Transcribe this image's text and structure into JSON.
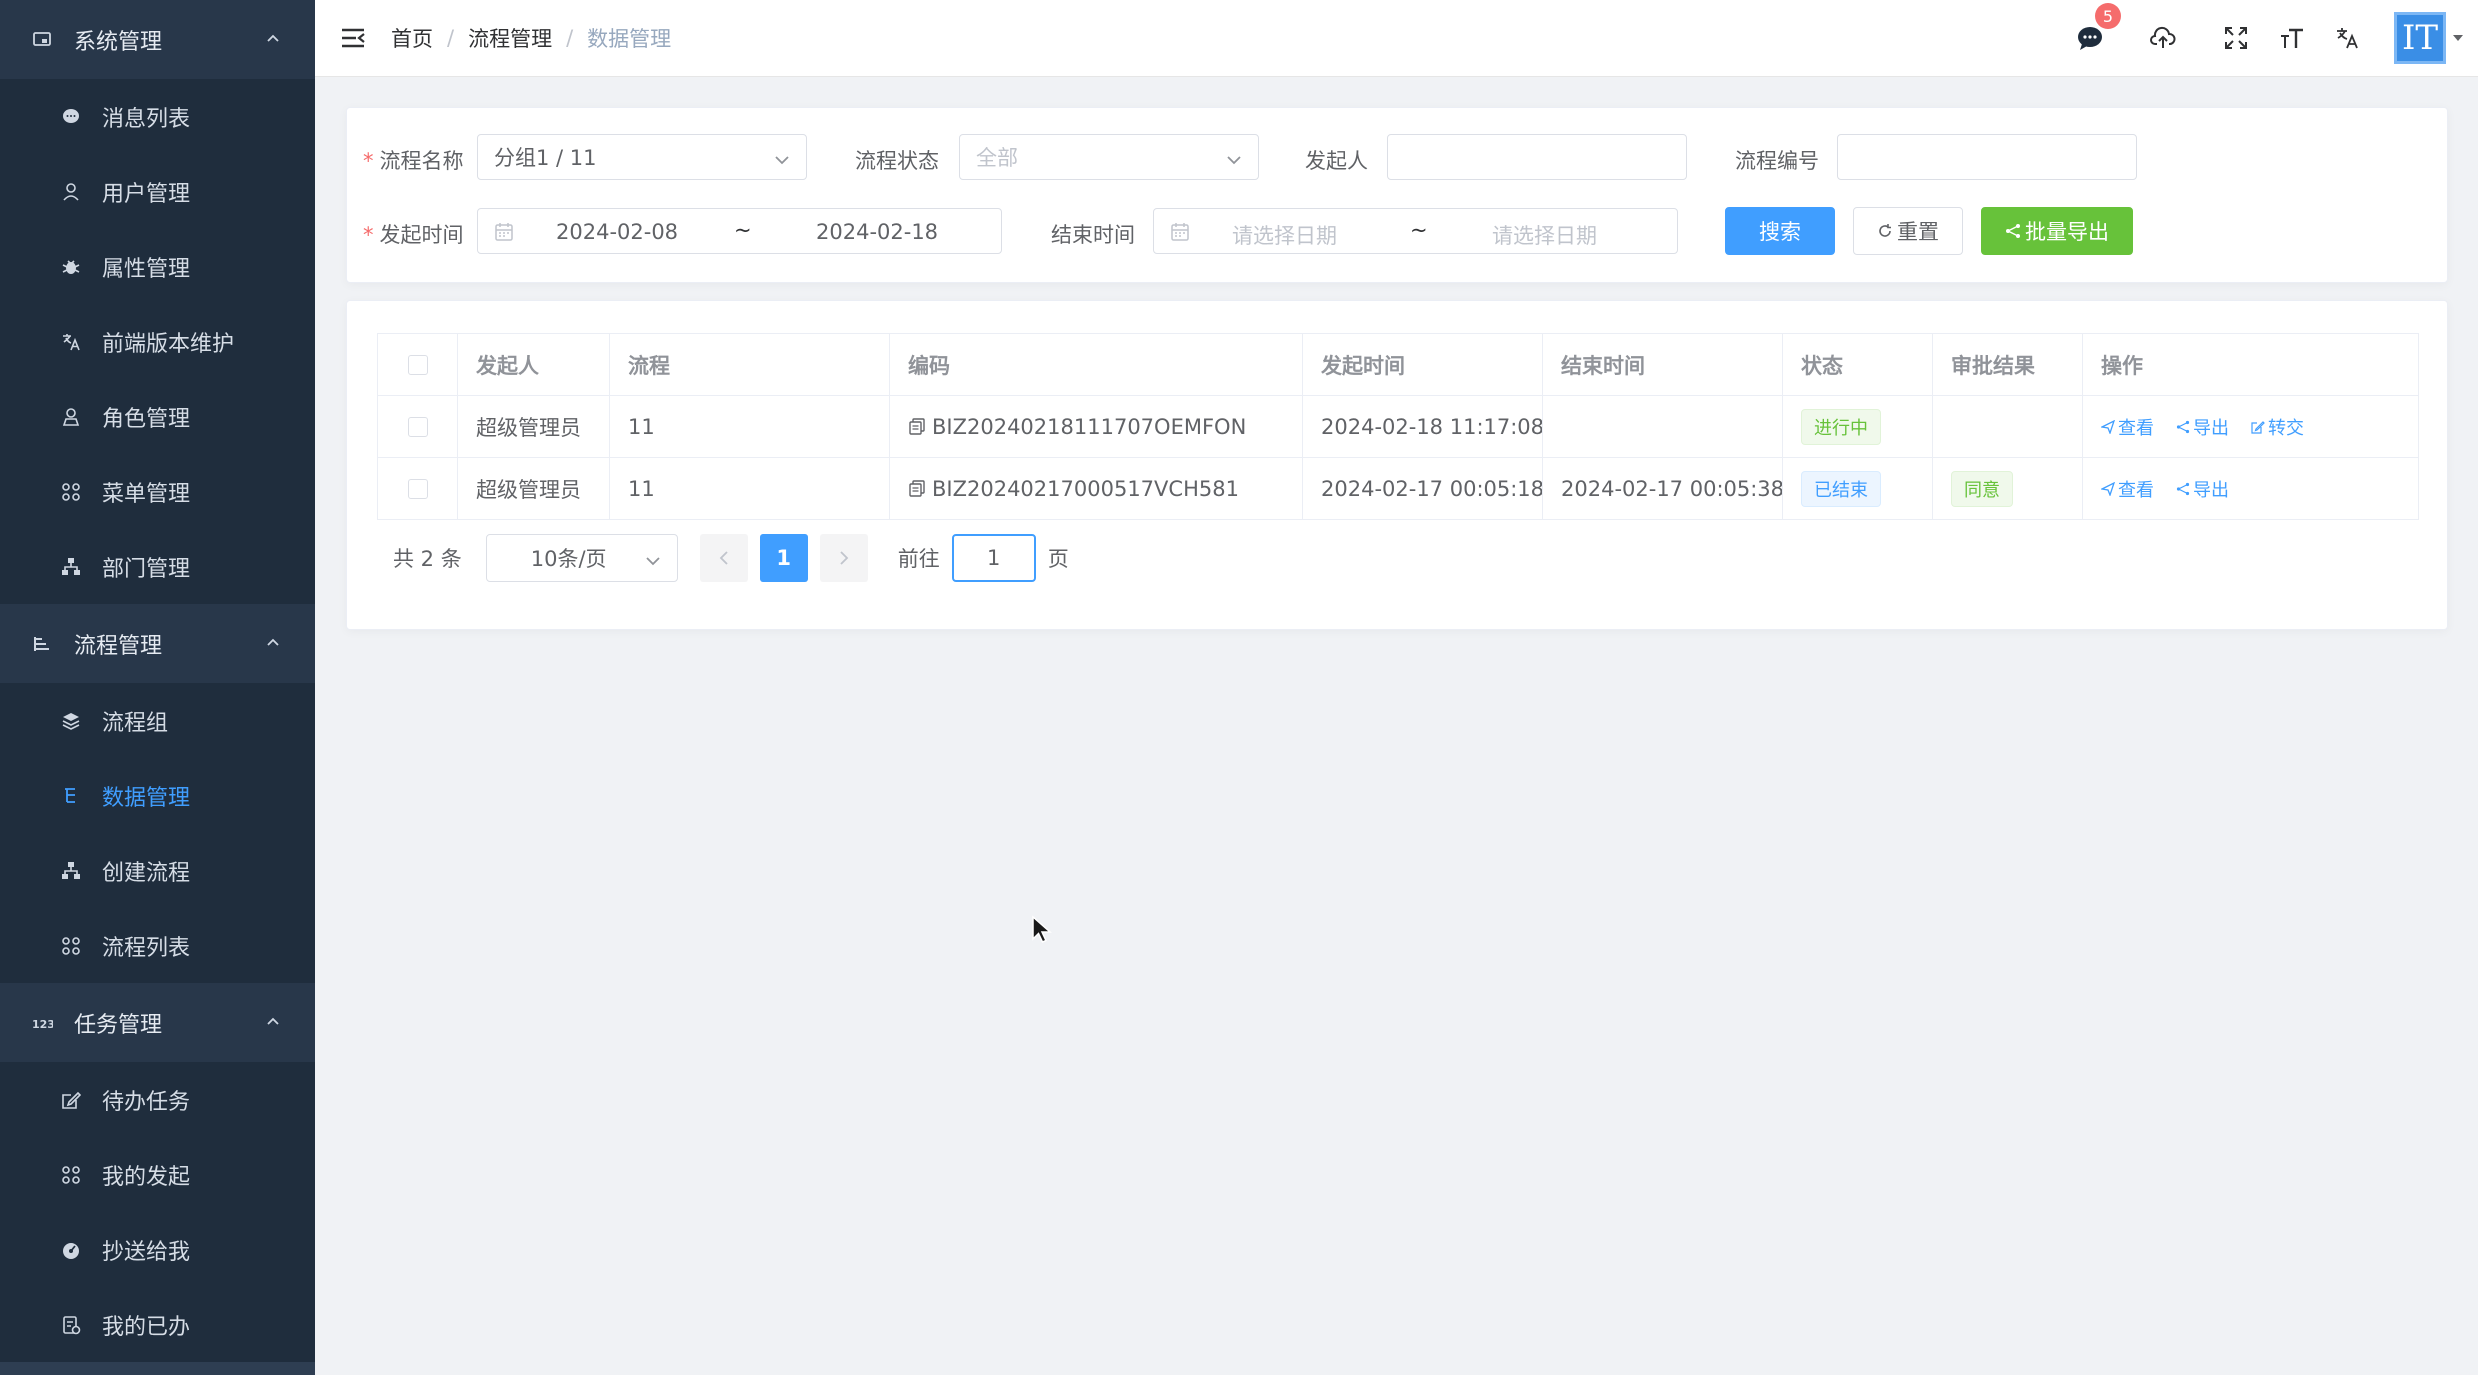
{
  "sidebar": {
    "groups": [
      {
        "label": "系统管理",
        "icon": "system-icon",
        "items": [
          {
            "label": "消息列表",
            "icon": "message-icon"
          },
          {
            "label": "用户管理",
            "icon": "user-icon"
          },
          {
            "label": "属性管理",
            "icon": "bug-icon"
          },
          {
            "label": "前端版本维护",
            "icon": "translate-icon"
          },
          {
            "label": "角色管理",
            "icon": "role-icon"
          },
          {
            "label": "菜单管理",
            "icon": "grid-icon"
          },
          {
            "label": "部门管理",
            "icon": "tree-icon"
          }
        ]
      },
      {
        "label": "流程管理",
        "icon": "flow-icon",
        "items": [
          {
            "label": "流程组",
            "icon": "layers-icon"
          },
          {
            "label": "数据管理",
            "icon": "data-icon",
            "active": true
          },
          {
            "label": "创建流程",
            "icon": "tree-icon"
          },
          {
            "label": "流程列表",
            "icon": "grid-icon"
          }
        ]
      },
      {
        "label": "任务管理",
        "icon": "number-icon",
        "items": [
          {
            "label": "待办任务",
            "icon": "edit-icon"
          },
          {
            "label": "我的发起",
            "icon": "grid-icon"
          },
          {
            "label": "抄送给我",
            "icon": "dashboard-icon"
          },
          {
            "label": "我的已办",
            "icon": "document-icon"
          }
        ]
      }
    ]
  },
  "header": {
    "breadcrumb": [
      "首页",
      "流程管理",
      "数据管理"
    ],
    "separator": "/",
    "notification_count": "5",
    "avatar_text": "IT"
  },
  "filter": {
    "process_name": {
      "label": "流程名称",
      "value": "分组1 / 11"
    },
    "process_status": {
      "label": "流程状态",
      "placeholder": "全部"
    },
    "initiator": {
      "label": "发起人",
      "value": ""
    },
    "process_no": {
      "label": "流程编号",
      "value": ""
    },
    "start_time": {
      "label": "发起时间",
      "from": "2024-02-08",
      "to": "2024-02-18",
      "sep": "~"
    },
    "end_time": {
      "label": "结束时间",
      "from_placeholder": "请选择日期",
      "to_placeholder": "请选择日期",
      "sep": "~"
    },
    "buttons": {
      "search": "搜索",
      "reset": "重置",
      "export": "批量导出"
    }
  },
  "table": {
    "columns": [
      "发起人",
      "流程",
      "编码",
      "发起时间",
      "结束时间",
      "状态",
      "审批结果",
      "操作"
    ],
    "rows": [
      {
        "initiator": "超级管理员",
        "process": "11",
        "code": "BIZ20240218111707OEMFON",
        "start": "2024-02-18 11:17:08",
        "end": "",
        "status": "进行中",
        "result": "",
        "actions": [
          "查看",
          "导出",
          "转交"
        ]
      },
      {
        "initiator": "超级管理员",
        "process": "11",
        "code": "BIZ20240217000517VCH581",
        "start": "2024-02-17 00:05:18",
        "end": "2024-02-17 00:05:38",
        "status": "已结束",
        "result": "同意",
        "actions": [
          "查看",
          "导出"
        ]
      }
    ]
  },
  "pagination": {
    "total": "共 2 条",
    "page_size": "10条/页",
    "current": "1",
    "goto_label": "前往",
    "goto_value": "1",
    "page_suffix": "页"
  },
  "colors": {
    "primary": "#409eff",
    "success": "#67c23a",
    "sidebar": "#2e3e52",
    "danger": "#f56c6c"
  }
}
